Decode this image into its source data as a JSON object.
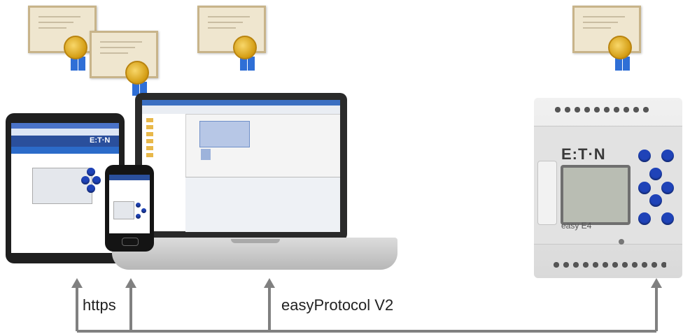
{
  "labels": {
    "https": "https",
    "protocol": "easyProtocol V2"
  },
  "plc": {
    "brand": "E:T·N",
    "model": "easy E4"
  },
  "tablet": {
    "brand": "E:T·N"
  },
  "colors": {
    "arrow": "#808080",
    "accent_blue": "#1f43b8",
    "eaton_text": "#3a3a3a"
  }
}
